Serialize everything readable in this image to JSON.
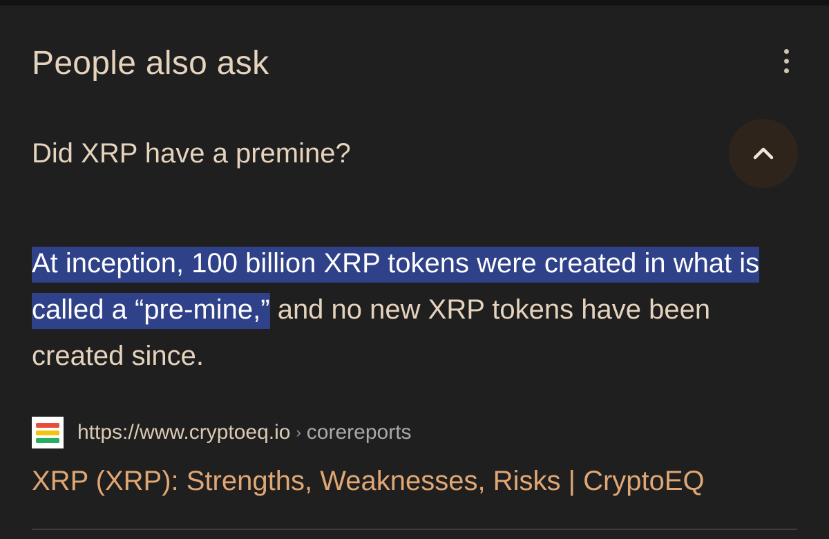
{
  "section": {
    "heading": "People also ask",
    "menu_icon": "more-vert-icon"
  },
  "question": {
    "text": "Did XRP have a premine?",
    "toggle_icon": "chevron-up-icon"
  },
  "answer": {
    "highlighted": "At inception, 100 billion XRP tokens were created in what is called a “pre-mine,”",
    "rest": " and no new XRP tokens have been created since."
  },
  "source": {
    "favicon_icon": "cryptoeq-logo-icon",
    "url": "https://www.cryptoeq.io",
    "separator": "›",
    "path": "corereports"
  },
  "result": {
    "title": "XRP (XRP): Strengths, Weaknesses, Risks | CryptoEQ"
  },
  "colors": {
    "background": "#1f1f1f",
    "text": "#e5d3bd",
    "highlight": "#2f4189",
    "link": "#e0a774",
    "toggle_bg": "#2f241c",
    "favicon_red": "#e74c3c",
    "favicon_yellow": "#f1c40f",
    "favicon_green": "#27ae60"
  }
}
